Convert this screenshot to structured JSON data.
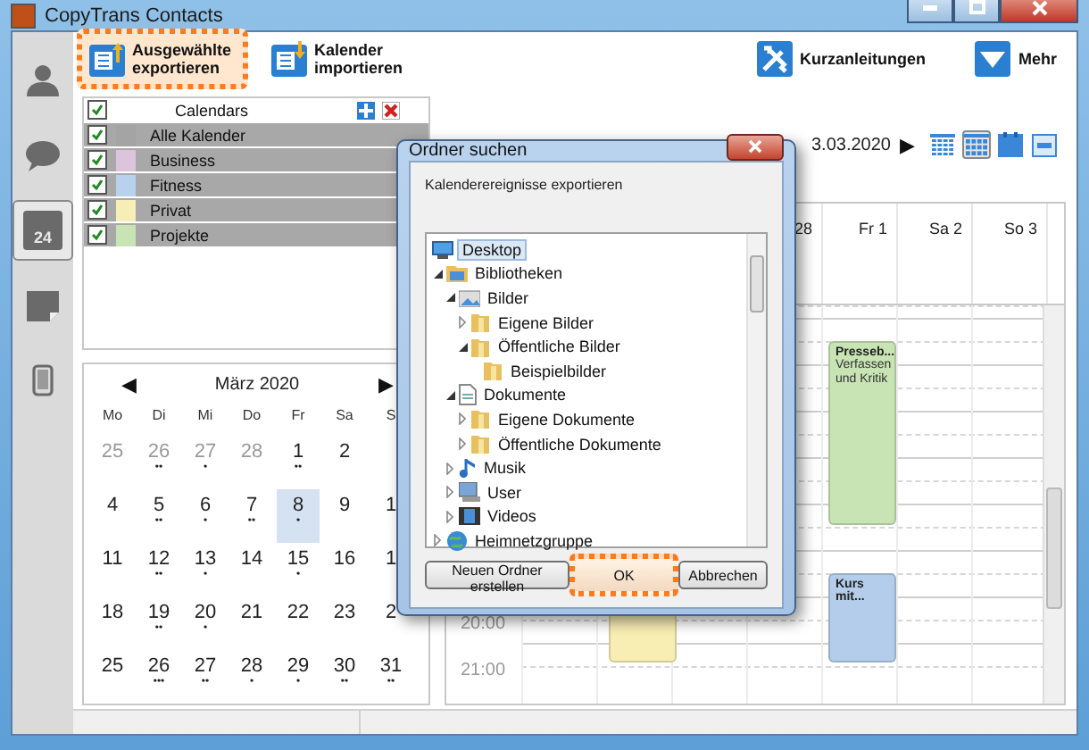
{
  "window": {
    "title": "CopyTrans Contacts"
  },
  "nav": [
    {
      "kind": "contacts",
      "selected": false
    },
    {
      "kind": "messages",
      "selected": false
    },
    {
      "kind": "calendar",
      "selected": true,
      "label": "24"
    },
    {
      "kind": "notes",
      "selected": false
    },
    {
      "kind": "device",
      "selected": false
    }
  ],
  "toolbar": [
    {
      "kind": "export",
      "label": "Ausgewählte exportieren",
      "highlighted": true
    },
    {
      "kind": "import",
      "label": "Kalender importieren",
      "highlighted": false
    }
  ],
  "toolbar_right": [
    {
      "kind": "tools",
      "label": "Kurzanleitungen"
    },
    {
      "kind": "more",
      "label": "Mehr"
    }
  ],
  "calendars": {
    "header": {
      "label": "Calendars",
      "checked": true
    },
    "items": [
      {
        "name": "Alle Kalender",
        "checked": true,
        "selected": true,
        "color": "#a4a4a4"
      },
      {
        "name": "Business",
        "checked": true,
        "selected": true,
        "color": "#dcc4dc"
      },
      {
        "name": "Fitness",
        "checked": true,
        "selected": true,
        "color": "#b8d2ee"
      },
      {
        "name": "Privat",
        "checked": true,
        "selected": true,
        "color": "#f6eeb4"
      },
      {
        "name": "Projekte",
        "checked": true,
        "selected": true,
        "color": "#c8e4b4"
      }
    ]
  },
  "mini_calendar": {
    "title": "März 2020",
    "prev": "◀",
    "next": "▶",
    "weekdays": [
      "Mo",
      "Di",
      "Mi",
      "Do",
      "Fr",
      "Sa",
      "S"
    ],
    "weeks": [
      [
        {
          "day": "25",
          "muted": true,
          "selected": false
        },
        {
          "day": "26",
          "muted": true,
          "selected": false,
          "marker": "••"
        },
        {
          "day": "27",
          "muted": true,
          "selected": false,
          "marker": "•"
        },
        {
          "day": "28",
          "muted": true,
          "selected": false
        },
        {
          "day": "1",
          "muted": false,
          "selected": false,
          "marker": "••"
        },
        {
          "day": "2",
          "muted": false,
          "selected": false
        }
      ],
      [
        {
          "day": "4",
          "muted": false,
          "selected": false
        },
        {
          "day": "5",
          "muted": false,
          "selected": false,
          "marker": "••"
        },
        {
          "day": "6",
          "muted": false,
          "selected": false,
          "marker": "•"
        },
        {
          "day": "7",
          "muted": false,
          "selected": false,
          "marker": "••"
        },
        {
          "day": "8",
          "muted": false,
          "selected": true,
          "marker": "•"
        },
        {
          "day": "9",
          "muted": false,
          "selected": false
        },
        {
          "day": "1",
          "muted": false,
          "selected": false
        }
      ],
      [
        {
          "day": "11",
          "muted": false,
          "selected": false
        },
        {
          "day": "12",
          "muted": false,
          "selected": false,
          "marker": "••"
        },
        {
          "day": "13",
          "muted": false,
          "selected": false,
          "marker": "•"
        },
        {
          "day": "14",
          "muted": false,
          "selected": false
        },
        {
          "day": "15",
          "muted": false,
          "selected": false,
          "marker": "•"
        },
        {
          "day": "16",
          "muted": false,
          "selected": false
        },
        {
          "day": "1",
          "muted": false,
          "selected": false
        }
      ],
      [
        {
          "day": "18",
          "muted": false,
          "selected": false
        },
        {
          "day": "19",
          "muted": false,
          "selected": false,
          "marker": "••"
        },
        {
          "day": "20",
          "muted": false,
          "selected": false,
          "marker": "•"
        },
        {
          "day": "21",
          "muted": false,
          "selected": false
        },
        {
          "day": "22",
          "muted": false,
          "selected": false
        },
        {
          "day": "23",
          "muted": false,
          "selected": false
        },
        {
          "day": "2",
          "muted": false,
          "selected": false
        }
      ],
      [
        {
          "day": "25",
          "muted": false,
          "selected": false
        },
        {
          "day": "26",
          "muted": false,
          "selected": false,
          "marker": "•••"
        },
        {
          "day": "27",
          "muted": false,
          "selected": false,
          "marker": "••"
        },
        {
          "day": "28",
          "muted": false,
          "selected": false,
          "marker": "•"
        },
        {
          "day": "29",
          "muted": false,
          "selected": false,
          "marker": "•"
        },
        {
          "day": "30",
          "muted": false,
          "selected": false,
          "marker": "••"
        },
        {
          "day": "31",
          "muted": false,
          "selected": false,
          "marker": "••"
        }
      ]
    ]
  },
  "week_view": {
    "date": "3.03.2020",
    "next": "▶",
    "views": [
      {
        "kind": "day",
        "selected": false
      },
      {
        "kind": "week",
        "selected": true
      },
      {
        "kind": "month",
        "selected": false
      },
      {
        "kind": "list",
        "selected": false
      }
    ],
    "days": [
      "28",
      "Fr 1",
      "Sa 2",
      "So 3"
    ],
    "time_labels": [
      "20:00",
      "21:00"
    ],
    "events": [
      {
        "title": "Presseb...",
        "detail": "Verfassen und Kritik",
        "color": "#c8e4b4"
      },
      {
        "title": "Kurs mit...",
        "color": "#b4cdea"
      },
      {
        "color": "#f8eeb4"
      }
    ]
  },
  "dialog": {
    "title": "Ordner suchen",
    "prompt": "Kalenderereignisse exportieren",
    "tree": [
      {
        "label": "Desktop",
        "kind": "desktop",
        "selected": true,
        "children": [
          {
            "label": "Bibliotheken",
            "kind": "library",
            "selected": false,
            "expanded": true,
            "children": [
              {
                "label": "Bilder",
                "kind": "pictures",
                "selected": false,
                "expanded": true,
                "children": [
                  {
                    "label": "Eigene Bilder",
                    "kind": "folder",
                    "selected": false,
                    "expanded": false
                  },
                  {
                    "label": "Öffentliche Bilder",
                    "kind": "folder",
                    "selected": false,
                    "expanded": true,
                    "children": [
                      {
                        "label": "Beispielbilder",
                        "kind": "folder",
                        "selected": false
                      }
                    ]
                  }
                ]
              },
              {
                "label": "Dokumente",
                "kind": "documents",
                "selected": false,
                "expanded": true,
                "children": [
                  {
                    "label": "Eigene Dokumente",
                    "kind": "folder",
                    "selected": false,
                    "expanded": false
                  },
                  {
                    "label": "Öffentliche Dokumente",
                    "kind": "folder",
                    "selected": false,
                    "expanded": false
                  }
                ]
              },
              {
                "label": "Musik",
                "kind": "music",
                "selected": false,
                "expanded": false
              },
              {
                "label": "User",
                "kind": "user",
                "selected": false,
                "expanded": false
              },
              {
                "label": "Videos",
                "kind": "videos",
                "selected": false,
                "expanded": false
              }
            ]
          },
          {
            "label": "Heimnetzgruppe",
            "kind": "network",
            "selected": false,
            "expanded": false
          }
        ]
      }
    ],
    "buttons": [
      {
        "label": "Neuen Ordner erstellen",
        "highlighted": false
      },
      {
        "label": "OK",
        "highlighted": true
      },
      {
        "label": "Abbrechen",
        "highlighted": false
      }
    ]
  }
}
